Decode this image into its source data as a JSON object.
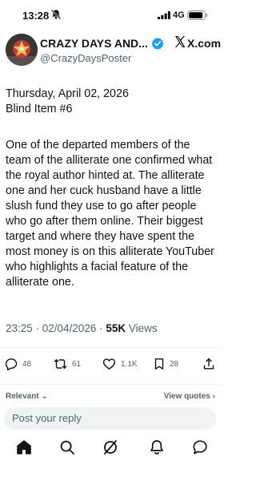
{
  "status": {
    "time": "13:28",
    "network": "4G"
  },
  "header": {
    "display_name": "CRAZY DAYS AND...",
    "handle": "@CrazyDaysPoster",
    "site": "X.com"
  },
  "tweet": {
    "date_line": "Thursday, April 02, 2026",
    "blind_line": "Blind Item #6",
    "text": "One of the departed members of the team of the alliterate one confirmed what the royal author hinted at. The alliterate one and her cuck husband have a little slush fund they use to go after people who go after them online. Their biggest target and where they have spent the most money is on this alliterate YouTuber who highlights a facial feature of the alliterate one.",
    "timestamp": "23:25 · 02/04/2026 · ",
    "views_count": "55K",
    "views_label": " Views"
  },
  "actions": {
    "replies": "48",
    "retweets": "61",
    "likes": "1.1K",
    "bookmarks": "28"
  },
  "replies_bar": {
    "sort_label": "Relevant",
    "view_quotes": "View quotes"
  },
  "composer": {
    "placeholder": "Post your reply"
  },
  "icons": [
    "bell-icon",
    "signal-icon",
    "battery-icon",
    "verified-icon",
    "x-logo-icon",
    "reply-icon",
    "retweet-icon",
    "like-icon",
    "bookmark-icon",
    "share-icon",
    "home-icon",
    "search-icon",
    "grok-icon",
    "notifications-icon",
    "messages-icon"
  ],
  "colors": {
    "verified": "#1d9bf0",
    "muted": "#536471",
    "text": "#0f1419",
    "composer_bg": "#eff3f4"
  }
}
